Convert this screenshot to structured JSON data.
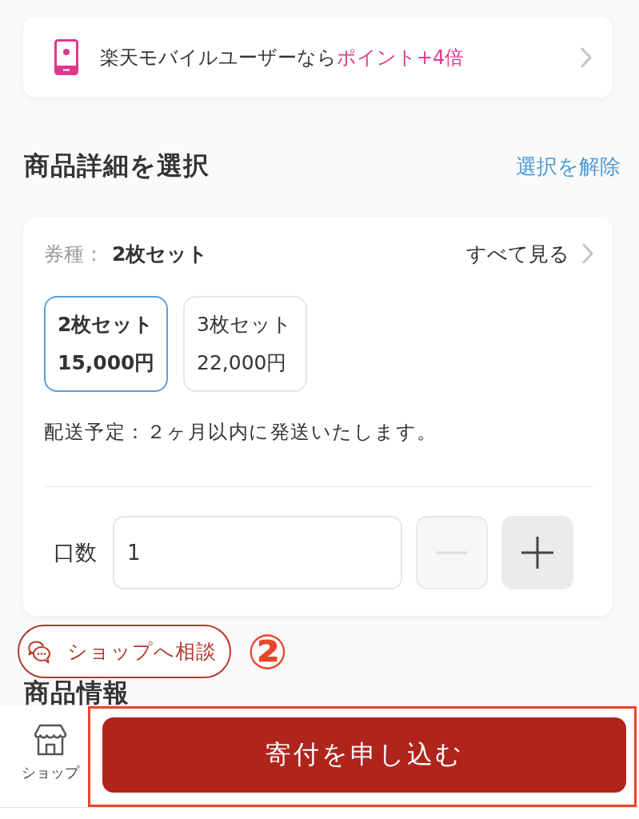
{
  "promo_banner": {
    "text": "楽天モバイルユーザーなら**ポイント+4倍**"
  },
  "section": {
    "title": "商品詳細を選択",
    "clear_link": "選択を解除"
  },
  "detail_card": {
    "type_label": "券種：",
    "type_value": "2枚セット",
    "see_all": "すべて見る",
    "options": [
      {
        "name": "2枚セット",
        "price": "15,000円",
        "selected": true
      },
      {
        "name": "3枚セット",
        "price": "22,000円",
        "selected": false
      }
    ],
    "delivery_note": "配送予定：２ヶ月以内に発送いたします。",
    "quantity": {
      "label": "口数",
      "value": "1",
      "buttons": [
        {
          "kind": "minus",
          "disabled": true
        },
        {
          "kind": "plus",
          "disabled": false
        }
      ]
    }
  },
  "consult_button": {
    "label": "ショップへ相談"
  },
  "annotation": {
    "label": "②"
  },
  "product_info": {
    "title": "商品情報"
  },
  "bottom_bar": {
    "shop_label": "ショップ",
    "apply_button": "寄付を申し込む",
    "highlighted": true
  }
}
